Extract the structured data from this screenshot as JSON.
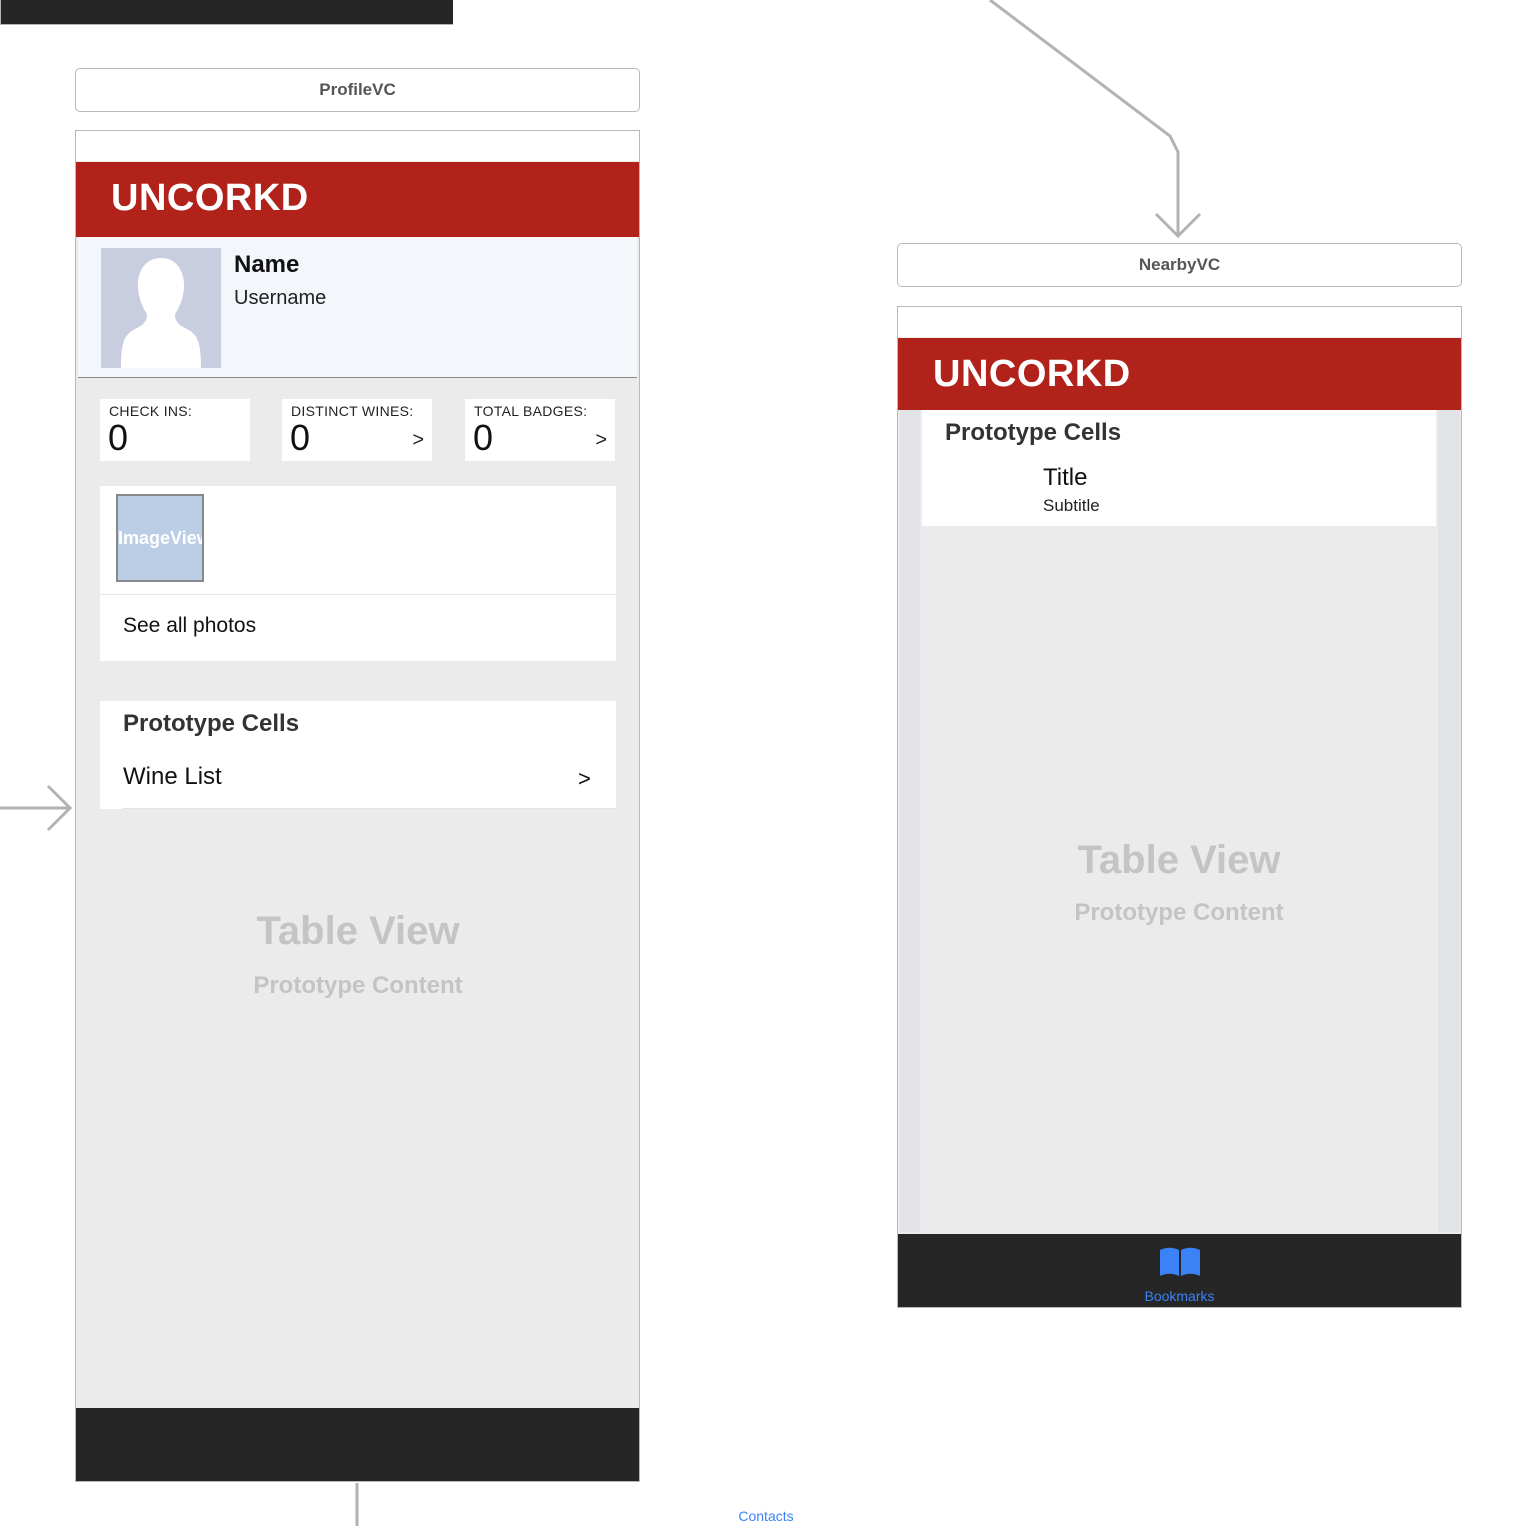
{
  "top_scene": {
    "tab_label": "Contacts"
  },
  "profile_scene": {
    "title": "ProfileVC",
    "brand": "UNCORKD",
    "name": "Name",
    "username": "Username",
    "stats": [
      {
        "caption": "CHECK INS:",
        "value": "0",
        "chevron": ""
      },
      {
        "caption": "DISTINCT WINES:",
        "value": "0",
        "chevron": ">"
      },
      {
        "caption": "TOTAL BADGES:",
        "value": "0",
        "chevron": ">"
      }
    ],
    "image_placeholder": "ImageView",
    "see_all_photos": "See all photos",
    "prototype_cells": "Prototype Cells",
    "wine_list": "Wine List",
    "wine_list_chevron": ">",
    "table_view": "Table View",
    "prototype_content": "Prototype Content"
  },
  "nearby_scene": {
    "title": "NearbyVC",
    "brand": "UNCORKD",
    "prototype_cells": "Prototype Cells",
    "cell_title": "Title",
    "cell_subtitle": "Subtitle",
    "table_view": "Table View",
    "prototype_content": "Prototype Content",
    "tab_label": "Bookmarks"
  },
  "colors": {
    "nav_red": "#b0221a",
    "tab_dark": "#262626",
    "tab_blue": "#3b82f6",
    "placeholder_gray": "#c4c4c4"
  }
}
